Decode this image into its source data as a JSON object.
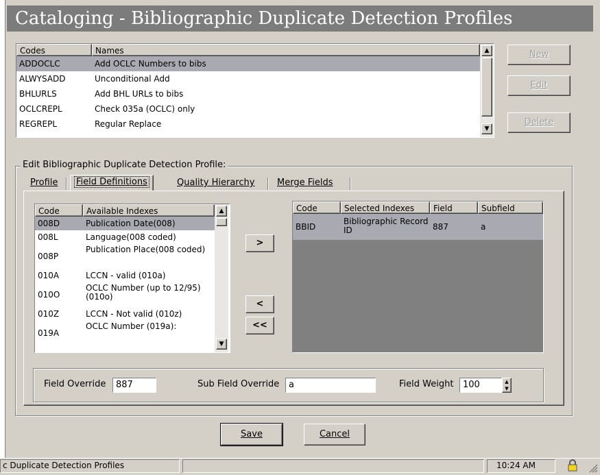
{
  "title": "Cataloging - Bibliographic Duplicate Detection Profiles",
  "profiles": {
    "headers": [
      "Codes",
      "Names"
    ],
    "rows": [
      {
        "code": "ADDOCLC",
        "name": "Add OCLC Numbers to bibs",
        "selected": true
      },
      {
        "code": "ALWYSADD",
        "name": "Unconditional Add"
      },
      {
        "code": "BHLURLS",
        "name": "Add BHL URLs to bibs"
      },
      {
        "code": "OCLCREPL",
        "name": "Check 035a (OCLC) only"
      },
      {
        "code": "REGREPL",
        "name": "Regular Replace"
      }
    ]
  },
  "side_buttons": {
    "new": "New",
    "edit": "Edit",
    "delete": "Delete"
  },
  "edit_group_label": "Edit  Bibliographic Duplicate Detection Profile:",
  "tabs": [
    "Profile",
    "Field Definitions",
    "Quality Hierarchy",
    "Merge Fields"
  ],
  "active_tab": "Field Definitions",
  "available": {
    "headers": [
      "Code",
      "Available Indexes"
    ],
    "rows": [
      {
        "code": "008D",
        "name": "Publication Date(008)",
        "selected": true
      },
      {
        "code": "008L",
        "name": "Language(008 coded)"
      },
      {
        "code": "008P",
        "name": "Publication Place(008 coded)"
      },
      {
        "code": "010A",
        "name": "LCCN - valid  (010a)"
      },
      {
        "code": "010O",
        "name": "OCLC Number (up to 12/95) (010o)"
      },
      {
        "code": "010Z",
        "name": "LCCN - Not valid (010z)"
      },
      {
        "code": "019A",
        "name": "OCLC Number (019a):"
      }
    ]
  },
  "move_buttons": {
    "add": ">",
    "remove": "<",
    "remove_all": "<<"
  },
  "selected": {
    "headers": [
      "Code",
      "Selected Indexes",
      "Field",
      "Subfield"
    ],
    "rows": [
      {
        "code": "BBID",
        "name": "Bibliographic Record ID",
        "field": "887",
        "subfield": "a"
      }
    ]
  },
  "overrides": {
    "field_override_label": "Field Override",
    "field_override_value": "887",
    "subfield_override_label": "Sub Field Override",
    "subfield_override_value": "a",
    "field_weight_label": "Field Weight",
    "field_weight_value": "100"
  },
  "actions": {
    "save": "Save",
    "cancel": "Cancel"
  },
  "status": {
    "text": "c Duplicate Detection Profiles",
    "time": "10:24 AM"
  }
}
